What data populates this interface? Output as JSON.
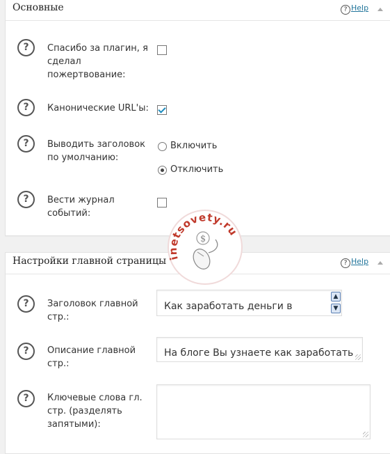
{
  "section_main": {
    "title": "Основные",
    "help_symbol": "?",
    "help_label": "Help",
    "rows": [
      {
        "label": "Спасибо за плагин, я сделал пожертвование:",
        "checked": false
      },
      {
        "label": "Канонические URL'ы:",
        "checked": true
      },
      {
        "label": "Выводить заголовок по умолчанию:",
        "options": [
          {
            "label": "Включить",
            "selected": false
          },
          {
            "label": "Отключить",
            "selected": true
          }
        ]
      },
      {
        "label": "Вести журнал событий:",
        "checked": false
      }
    ]
  },
  "section_home": {
    "title": "Настройки главной страницы",
    "help_symbol": "?",
    "help_label": "Help",
    "fields": [
      {
        "label": "Заголовок главной стр.:",
        "value": "Как заработать деньги в"
      },
      {
        "label": "Описание главной стр.:",
        "value": "На блоге Вы узнаете как заработать"
      },
      {
        "label": "Ключевые слова гл. стр. (разделять запятыми):",
        "value": ""
      }
    ]
  },
  "question_symbol": "?",
  "watermark": {
    "text": "inetsovety.ru",
    "symbol": "$"
  },
  "colors": {
    "checkmark": "#1e8cbe",
    "link": "#21759b"
  },
  "icons": [
    "question-circle-icon",
    "collapse-arrow-icon",
    "scroll-up-icon",
    "scroll-down-icon",
    "resize-grip-icon",
    "mouse-icon"
  ]
}
